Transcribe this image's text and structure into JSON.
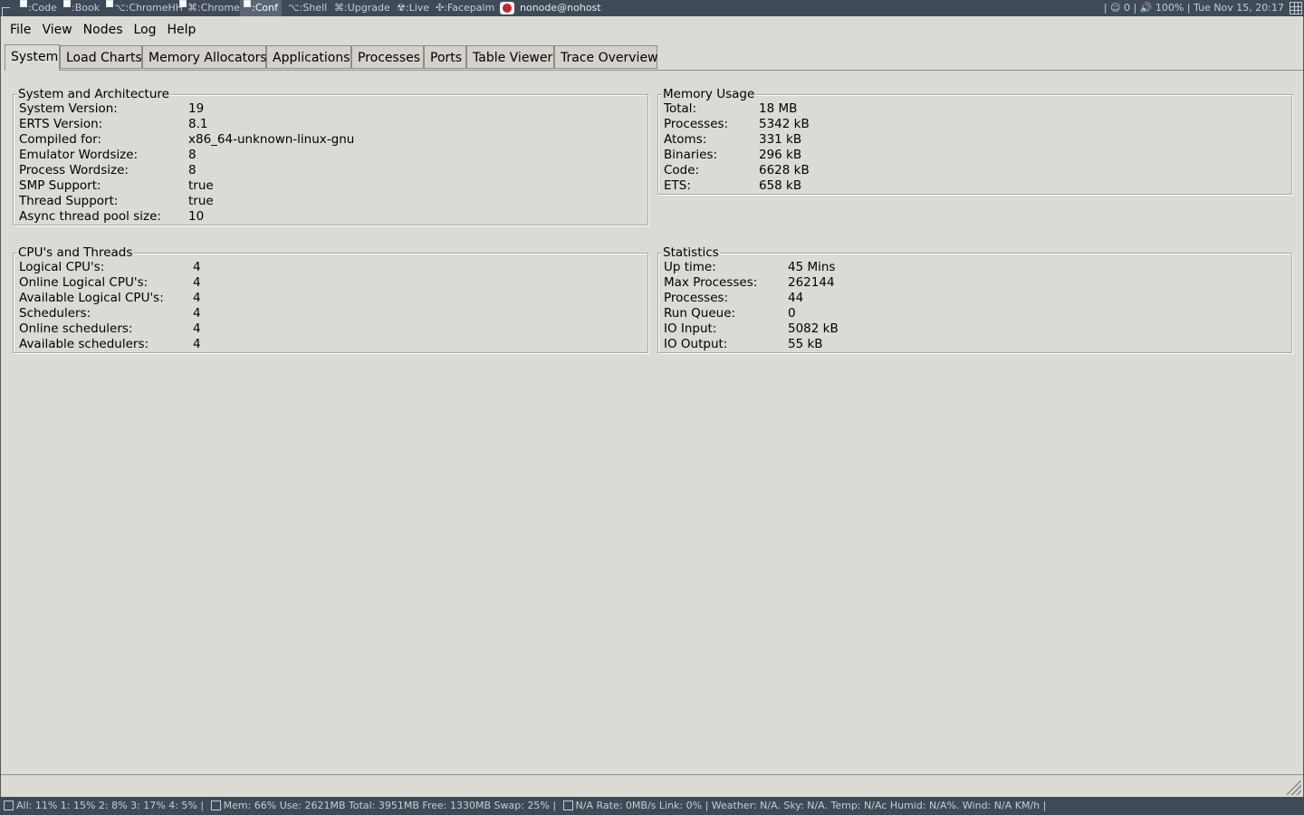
{
  "topbar": {
    "workspaces": [
      {
        "label": ":Code"
      },
      {
        "label": ":Book"
      },
      {
        "label": "⌥:ChromeHH"
      },
      {
        "label": "⌘:ChromeE"
      },
      {
        "label": ":Conf"
      },
      {
        "label": "⌥:Shell"
      },
      {
        "label": "⌘:Upgrade"
      },
      {
        "label": "☢:Live"
      },
      {
        "label": "✣:Facepalm"
      }
    ],
    "active_workspace": ":Conf",
    "window_title": "nonode@nohost",
    "tray_text": "|  ☺ 0 |  🔊 100%  |  Tue Nov 15, 20:17"
  },
  "menubar": {
    "file": "File",
    "view": "View",
    "nodes": "Nodes",
    "log": "Log",
    "help": "Help"
  },
  "tabs": {
    "system": "System",
    "load_charts": "Load Charts",
    "memory_allocators": "Memory Allocators",
    "applications": "Applications",
    "processes": "Processes",
    "ports": "Ports",
    "table_viewer": "Table Viewer",
    "trace_overview": "Trace Overview"
  },
  "system_arch": {
    "title": "System and Architecture",
    "rows": [
      {
        "k": "System Version:",
        "v": "19"
      },
      {
        "k": "ERTS Version:",
        "v": "8.1"
      },
      {
        "k": "Compiled for:",
        "v": "x86_64-unknown-linux-gnu"
      },
      {
        "k": "Emulator Wordsize:",
        "v": "8"
      },
      {
        "k": "Process Wordsize:",
        "v": "8"
      },
      {
        "k": "SMP Support:",
        "v": "true"
      },
      {
        "k": "Thread Support:",
        "v": "true"
      },
      {
        "k": "Async thread pool size:",
        "v": "10"
      }
    ]
  },
  "memory": {
    "title": "Memory Usage",
    "rows": [
      {
        "k": "Total:",
        "v": "18 MB"
      },
      {
        "k": "Processes:",
        "v": "5342 kB"
      },
      {
        "k": "Atoms:",
        "v": "331 kB"
      },
      {
        "k": "Binaries:",
        "v": "296 kB"
      },
      {
        "k": "Code:",
        "v": "6628 kB"
      },
      {
        "k": "ETS:",
        "v": "658 kB"
      }
    ]
  },
  "cpu": {
    "title": "CPU's and Threads",
    "rows": [
      {
        "k": "Logical CPU's:",
        "v": "4"
      },
      {
        "k": "Online Logical CPU's:",
        "v": "4"
      },
      {
        "k": "Available Logical CPU's:",
        "v": "4"
      },
      {
        "k": "Schedulers:",
        "v": "4"
      },
      {
        "k": "Online schedulers:",
        "v": "4"
      },
      {
        "k": "Available schedulers:",
        "v": "4"
      }
    ]
  },
  "stats": {
    "title": "Statistics",
    "rows": [
      {
        "k": "Up time:",
        "v": "45 Mins"
      },
      {
        "k": "Max Processes:",
        "v": "262144"
      },
      {
        "k": "Processes:",
        "v": "44"
      },
      {
        "k": "Run Queue:",
        "v": "0"
      },
      {
        "k": "IO Input:",
        "v": "5082 kB"
      },
      {
        "k": "IO Output:",
        "v": "55 kB"
      }
    ]
  },
  "statusbar": {
    "cpu": "All: 11% 1: 15% 2: 8% 3: 17% 4: 5% |",
    "mem": "Mem: 66% Use: 2621MB Total: 3951MB Free: 1330MB Swap: 25% |",
    "net": "N/A Rate: 0MB/s Link: 0% | Weather: N/A. Sky: N/A. Temp: N/Ac Humid: N/A%. Wind: N/A KM/h |"
  }
}
